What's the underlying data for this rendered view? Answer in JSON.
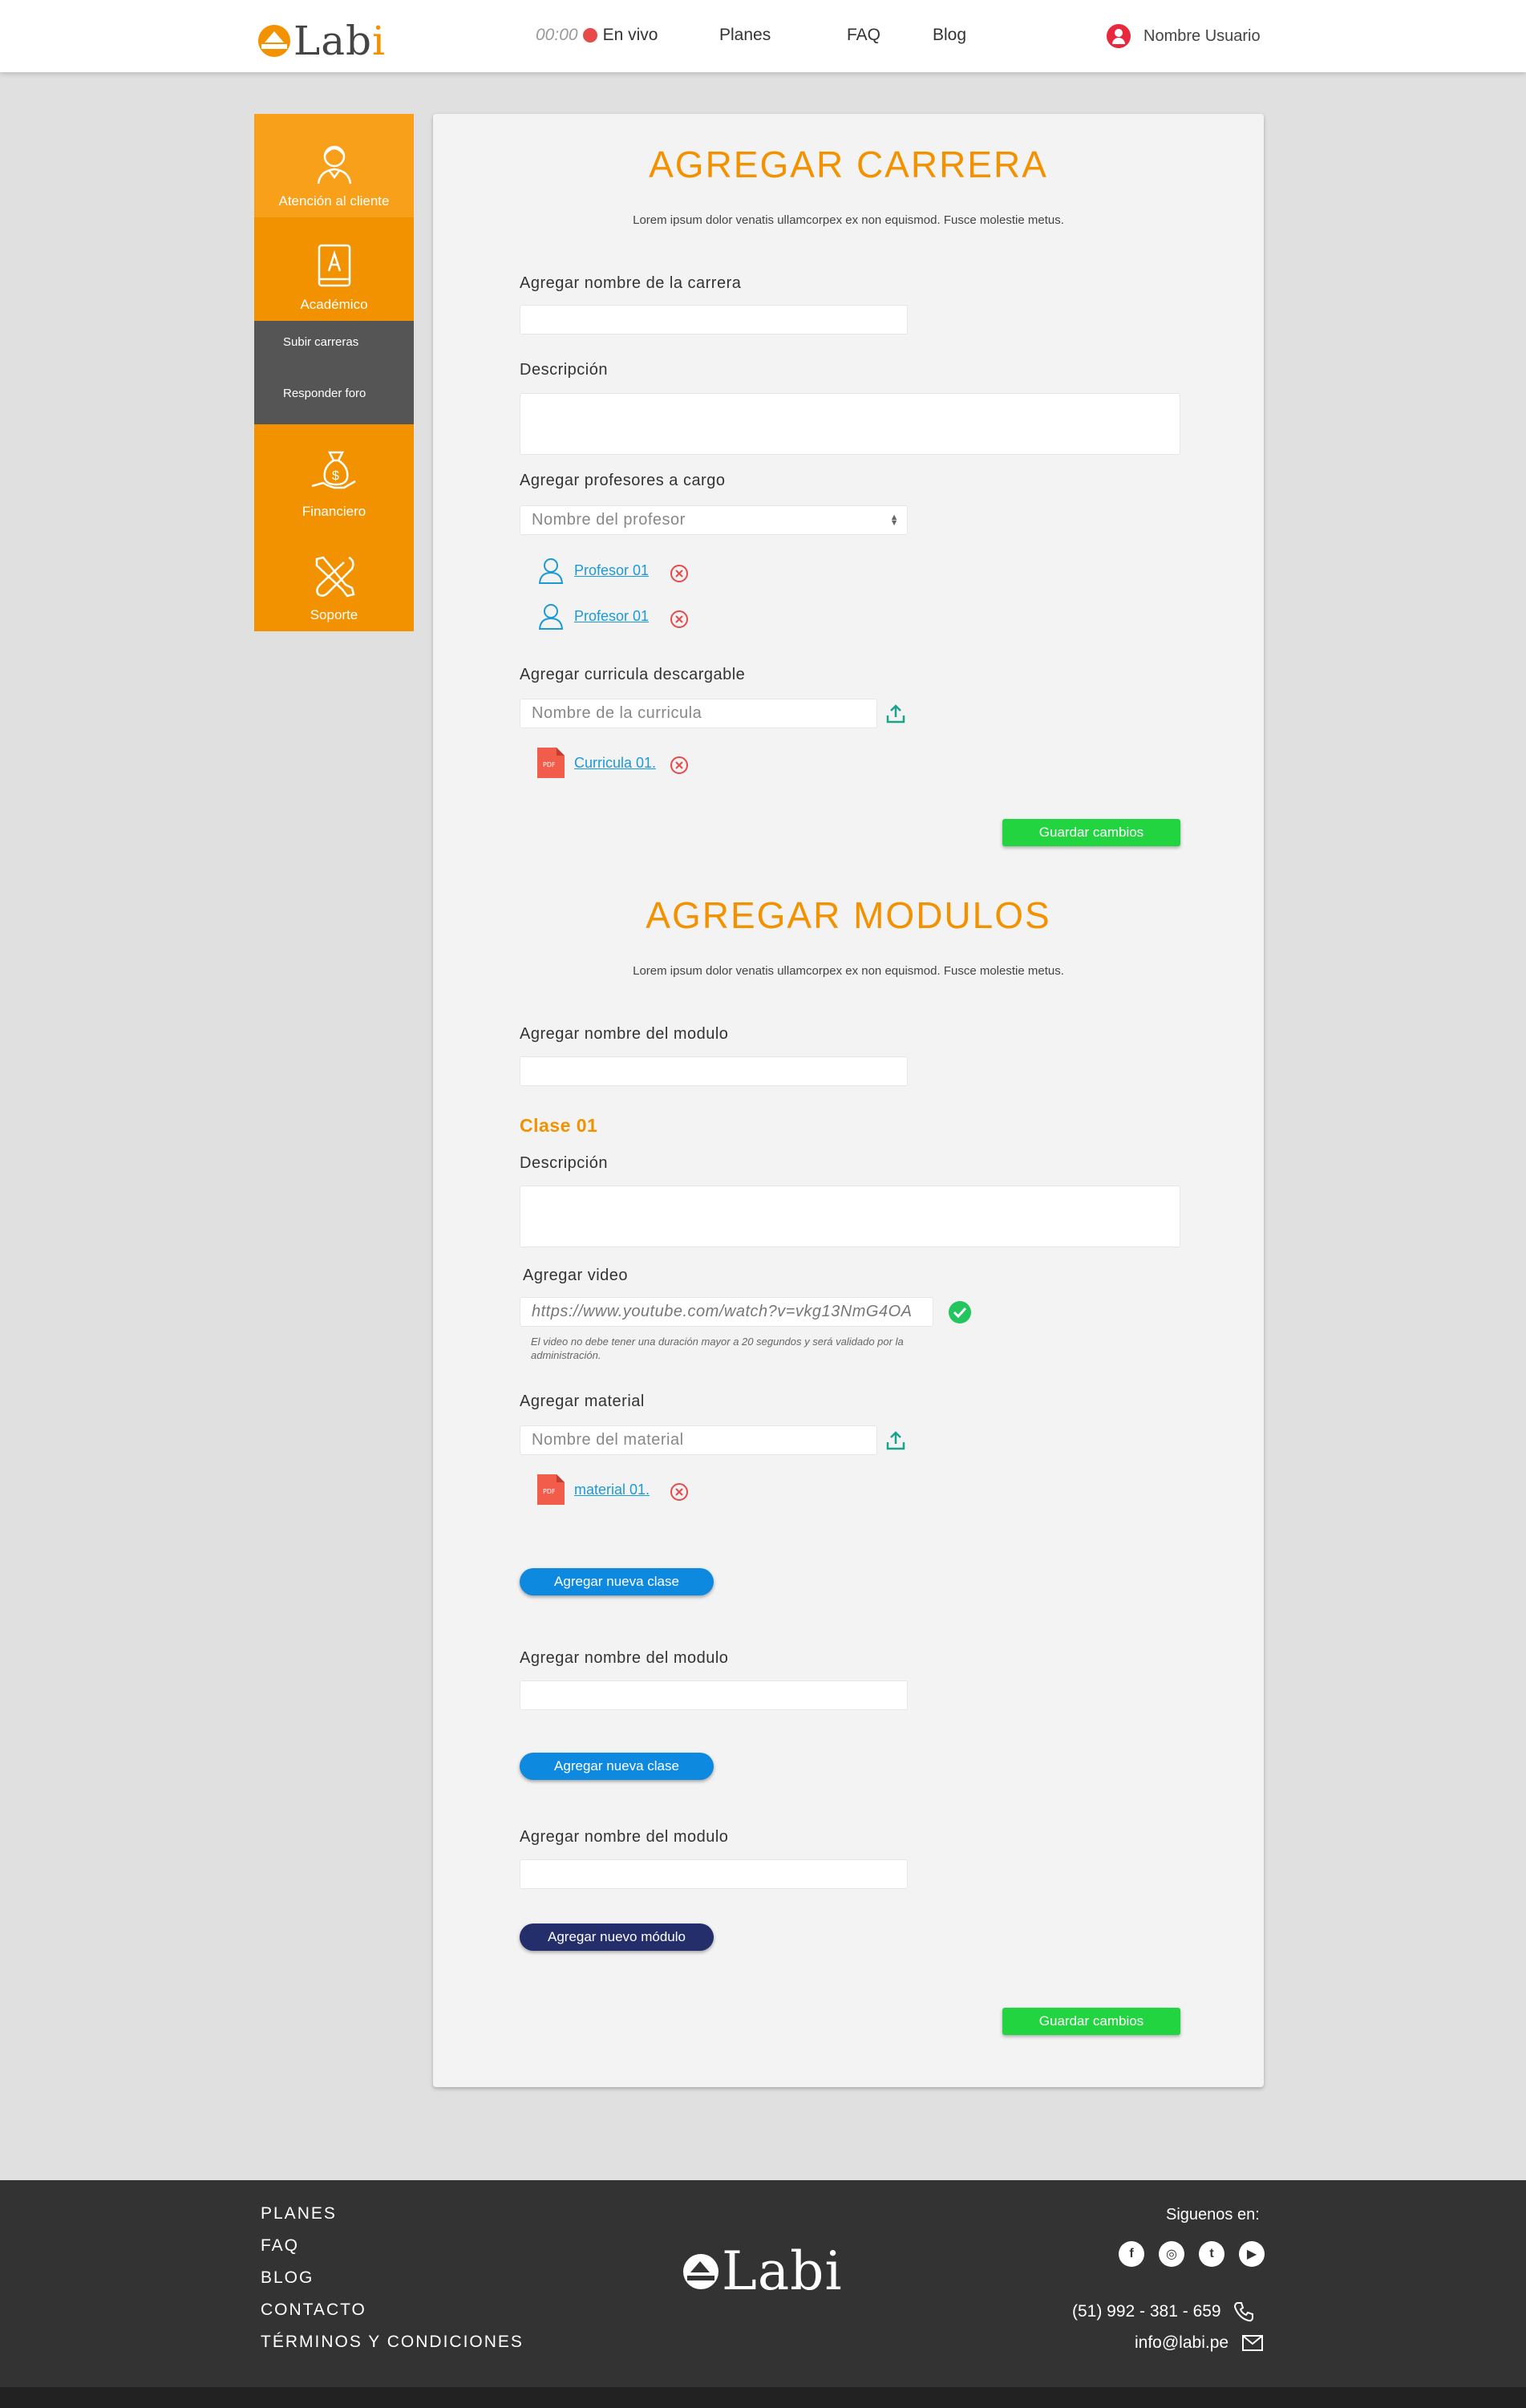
{
  "brand": {
    "name_main": "Lab",
    "name_accent": "i",
    "accent_color": "#f39200"
  },
  "nav": {
    "timer": "00:00",
    "live_label": "En vivo",
    "items": [
      "Planes",
      "FAQ",
      "Blog"
    ],
    "user_name": "Nombre Usuario"
  },
  "sidebar": {
    "items": [
      {
        "label": "Atención al cliente",
        "icon": "agent-icon",
        "color": "#f9a01b"
      },
      {
        "label": "Académico",
        "icon": "book-icon",
        "color": "#f39200"
      },
      {
        "label": "Financiero",
        "icon": "money-bag-icon",
        "color": "#f39200"
      },
      {
        "label": "Soporte",
        "icon": "tools-icon",
        "color": "#f39200"
      }
    ],
    "sub_items": [
      "Subir carreras",
      "Responder foro"
    ]
  },
  "carrera": {
    "title": "AGREGAR CARRERA",
    "subtitle": "Lorem ipsum dolor venatis ullamcorpex ex non equismod. Fusce molestie metus.",
    "name_label": "Agregar nombre de la carrera",
    "desc_label": "Descripción",
    "prof_label": "Agregar profesores a cargo",
    "prof_placeholder": "Nombre del profesor",
    "professors": [
      "Profesor 01",
      "Profesor 01"
    ],
    "curr_label": "Agregar curricula descargable",
    "curr_placeholder": "Nombre de la curricula",
    "curr_file": "Curricula 01.",
    "save": "Guardar cambios"
  },
  "modulos": {
    "title": "AGREGAR MODULOS",
    "subtitle": "Lorem ipsum dolor venatis ullamcorpex ex non equismod. Fusce molestie metus.",
    "module_label": "Agregar nombre del modulo",
    "class_title": "Clase 01",
    "desc_label": "Descripción",
    "video_label": "Agregar video",
    "video_value": "https://www.youtube.com/watch?v=vkg13NmG4OA",
    "video_hint": "El video no debe tener una duración mayor a 20 segundos y será validado por la administración.",
    "material_label": "Agregar material",
    "material_placeholder": "Nombre del material",
    "material_file": "material 01.",
    "add_class": "Agregar nueva clase",
    "add_module": "Agregar nuevo módulo",
    "save": "Guardar cambios"
  },
  "footer": {
    "links": [
      "PLANES",
      "FAQ",
      "BLOG",
      "CONTACTO",
      "TÉRMINOS Y CONDICIONES"
    ],
    "follow": "Siguenos en:",
    "social": [
      "facebook-icon",
      "instagram-icon",
      "twitter-icon",
      "youtube-icon"
    ],
    "phone": "(51) 992 - 381 - 659",
    "email": "info@labi.pe"
  }
}
